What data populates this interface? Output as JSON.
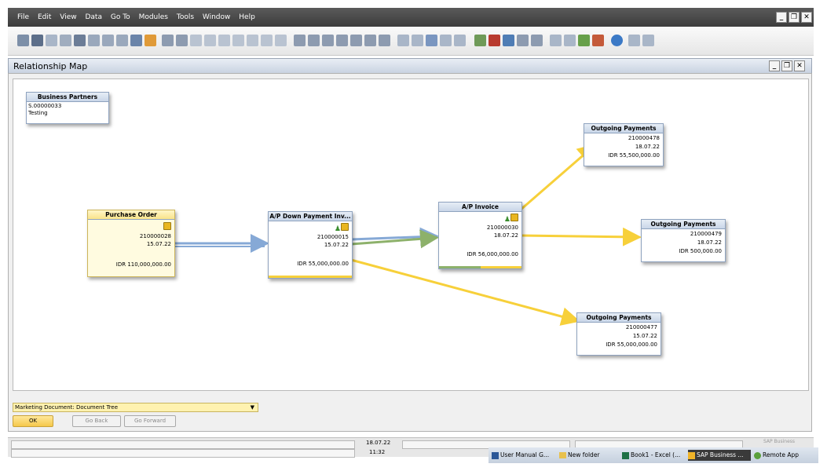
{
  "menu": [
    "File",
    "Edit",
    "View",
    "Data",
    "Go To",
    "Modules",
    "Tools",
    "Window",
    "Help"
  ],
  "window": {
    "title": "Relationship Map"
  },
  "nodes": {
    "bp": {
      "title": "Business Partners",
      "code": "S.00000033",
      "name": "Testing"
    },
    "po": {
      "title": "Purchase Order",
      "number": "210000028",
      "date": "15.07.22",
      "amount": "IDR 110,000,000.00"
    },
    "dp": {
      "title": "A/P Down Payment Inv...",
      "number": "210000015",
      "date": "15.07.22",
      "amount": "IDR 55,000,000.00"
    },
    "inv": {
      "title": "A/P Invoice",
      "number": "210000030",
      "date": "18.07.22",
      "amount": "IDR 56,000,000.00"
    },
    "op1": {
      "title": "Outgoing Payments",
      "number": "210000478",
      "date": "18.07.22",
      "amount": "IDR 55,500,000.00"
    },
    "op2": {
      "title": "Outgoing Payments",
      "number": "210000479",
      "date": "18.07.22",
      "amount": "IDR 500,000.00"
    },
    "op3": {
      "title": "Outgoing Payments",
      "number": "210000477",
      "date": "15.07.22",
      "amount": "IDR 55,000,000.00"
    }
  },
  "view_select": {
    "value": "Marketing Document: Document Tree"
  },
  "buttons": {
    "ok": "OK",
    "back": "Go Back",
    "forward": "Go Forward"
  },
  "status": {
    "date": "18.07.22",
    "time": "11:32",
    "brand": "SAP Business"
  },
  "taskbar": [
    "User Manual G...",
    "New folder",
    "Book1 - Excel (...",
    "SAP Business ...",
    "Remote App"
  ],
  "colors": {
    "link_blue": "#86a9d6",
    "link_green": "#8db16b",
    "link_yellow": "#f7d03a",
    "header_dark": "#3c3c3c"
  }
}
